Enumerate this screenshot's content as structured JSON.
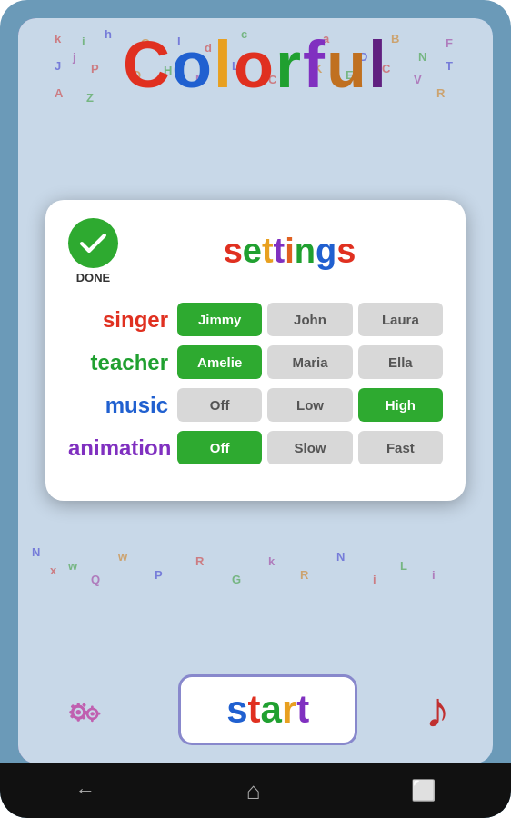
{
  "app": {
    "title_letters": [
      "C",
      "o",
      "l",
      "o",
      "r",
      "f",
      "u",
      "l"
    ],
    "title": "Colorful"
  },
  "done_button": {
    "label": "DONE"
  },
  "settings": {
    "title": "settings",
    "rows": [
      {
        "label": "singer",
        "options": [
          "Jimmy",
          "John",
          "Laura"
        ],
        "selected": 0
      },
      {
        "label": "teacher",
        "options": [
          "Amelie",
          "Maria",
          "Ella"
        ],
        "selected": 0
      },
      {
        "label": "music",
        "options": [
          "Off",
          "Low",
          "High"
        ],
        "selected": 2
      },
      {
        "label": "animation",
        "options": [
          "Off",
          "Slow",
          "Fast"
        ],
        "selected": 0
      }
    ]
  },
  "bottom": {
    "start_label": "start"
  },
  "nav": {
    "back": "←",
    "home": "⌂",
    "recent": "▣"
  }
}
